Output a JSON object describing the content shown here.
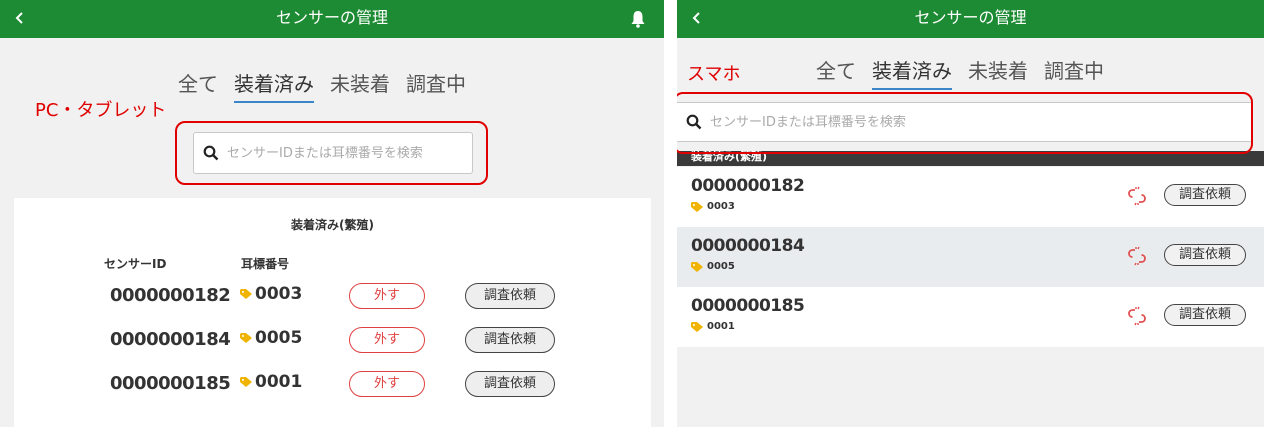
{
  "pc": {
    "title": "センサーの管理",
    "tabs": [
      "全て",
      "装着済み",
      "未装着",
      "調査中"
    ],
    "active_tab": 1,
    "note": "PC・タブレット",
    "search_placeholder": "センサーIDまたは耳標番号を検索",
    "section_title": "装着済み(繁殖)",
    "col_sensor_id": "センサーID",
    "col_ear_tag": "耳標番号",
    "remove_label": "外す",
    "request_label": "調査依頼",
    "rows": [
      {
        "sensor_id": "0000000182",
        "ear_tag": "0003"
      },
      {
        "sensor_id": "0000000184",
        "ear_tag": "0005"
      },
      {
        "sensor_id": "0000000185",
        "ear_tag": "0001"
      }
    ]
  },
  "sp": {
    "title": "センサーの管理",
    "tabs": [
      "全て",
      "装着済み",
      "未装着",
      "調査中"
    ],
    "active_tab": 1,
    "note": "スマホ",
    "search_placeholder": "センサーIDまたは耳標番号を検索",
    "section_title": "装着済み(繁殖)",
    "request_label": "調査依頼",
    "rows": [
      {
        "sensor_id": "0000000182",
        "ear_tag": "0003"
      },
      {
        "sensor_id": "0000000184",
        "ear_tag": "0005"
      },
      {
        "sensor_id": "0000000185",
        "ear_tag": "0001"
      }
    ]
  },
  "colors": {
    "appbar": "#1d8b33",
    "accent_underline": "#3a86c8",
    "annotation_red": "#e00000",
    "tag_yellow": "#f0b400",
    "unlink_red": "#e05050"
  }
}
